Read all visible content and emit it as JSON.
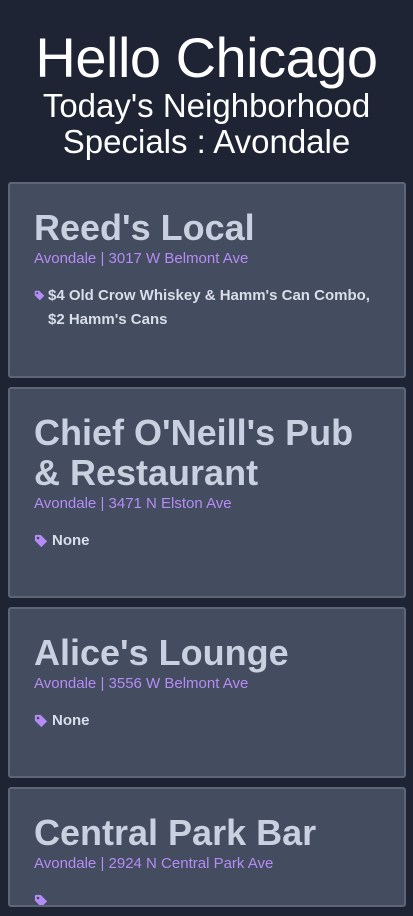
{
  "header": {
    "title": "Hello Chicago",
    "subtitle": "Today's Neighborhood Specials : Avondale"
  },
  "colors": {
    "background": "#1e2433",
    "card": "#444c5f",
    "accent": "#b58cf5",
    "title_text": "#c9d1e0"
  },
  "bars": [
    {
      "name": "Reed's Local",
      "address": "Avondale | 3017 W Belmont Ave",
      "special": "$4 Old Crow Whiskey & Hamm's Can Combo, $2 Hamm's Cans",
      "icon": "tag-icon"
    },
    {
      "name": "Chief O'Neill's Pub & Restaurant",
      "address": "Avondale | 3471 N Elston Ave",
      "special": "None",
      "icon": "tag-icon"
    },
    {
      "name": "Alice's Lounge",
      "address": "Avondale | 3556 W Belmont Ave",
      "special": "None",
      "icon": "tag-icon"
    },
    {
      "name": "Central Park Bar",
      "address": "Avondale | 2924 N Central Park Ave",
      "special": "",
      "icon": "tag-icon"
    }
  ]
}
